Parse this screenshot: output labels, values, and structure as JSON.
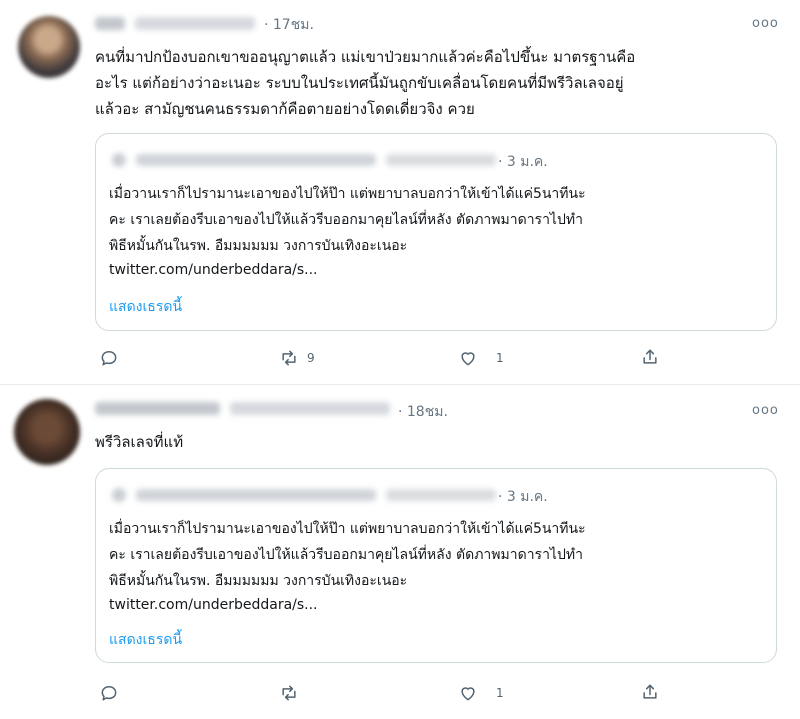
{
  "tweets": [
    {
      "time": "· 17ชม.",
      "more": "ooo",
      "text": "คนที่มาปกป้องบอกเขาขออนุญาตแล้ว แม่เขาป่วยมากแล้วค่ะคือไปขึ้นะ มาตรฐานคือ\nอะไร แต่ก้อย่างว่าอะเนอะ ระบบในประเทศนี้มันถูกขับเคลื่อนโดยคนที่มีพรีวิลเลจอยู่\nแล้วอะ สามัญชนคนธรรมดาก้คือตายอย่างโดดเดี่ยวจิง ควย",
      "quote": {
        "date": "· 3 ม.ค.",
        "text": "เมื่อวานเราก็ไปรามานะเอาของไปให้ป๊า แต่พยาบาลบอกว่าให้เข้าได้แค่5นาทีนะ\nคะ เราเลยต้องรีบเอาของไปให้แล้วรีบออกมาคุยไลน์ที่หลัง ตัดภาพมาดาราไปทำ\nพิธีหมั้นกันในรพ. อืมมมมมม วงการบันเทิงอะเนอะ",
        "link": "twitter.com/underbeddara/s...",
        "show_thread": "แสดงเธรดนี้"
      },
      "actions": {
        "reply": "",
        "retweet": "9",
        "like": "1",
        "share": ""
      }
    },
    {
      "time": "· 18ชม.",
      "more": "ooo",
      "text": "พรีวิลเลจที่แท้",
      "quote": {
        "date": "· 3 ม.ค.",
        "text": "เมื่อวานเราก็ไปรามานะเอาของไปให้ป๊า แต่พยาบาลบอกว่าให้เข้าได้แค่5นาทีนะ\nคะ เราเลยต้องรีบเอาของไปให้แล้วรีบออกมาคุยไลน์ที่หลัง ตัดภาพมาดาราไปทำ\nพิธีหมั้นกันในรพ. อืมมมมมม วงการบันเทิงอะเนอะ",
        "link": "twitter.com/underbeddara/s...",
        "show_thread": "แสดงเธรดนี้"
      },
      "actions": {
        "reply": "",
        "retweet": "",
        "like": "1",
        "share": ""
      }
    }
  ],
  "colors": {
    "accent": "#1d9bf0",
    "muted": "#657786",
    "border": "#cfd9de"
  },
  "icons": [
    "reply-icon",
    "retweet-icon",
    "like-icon",
    "share-icon",
    "more-icon"
  ]
}
